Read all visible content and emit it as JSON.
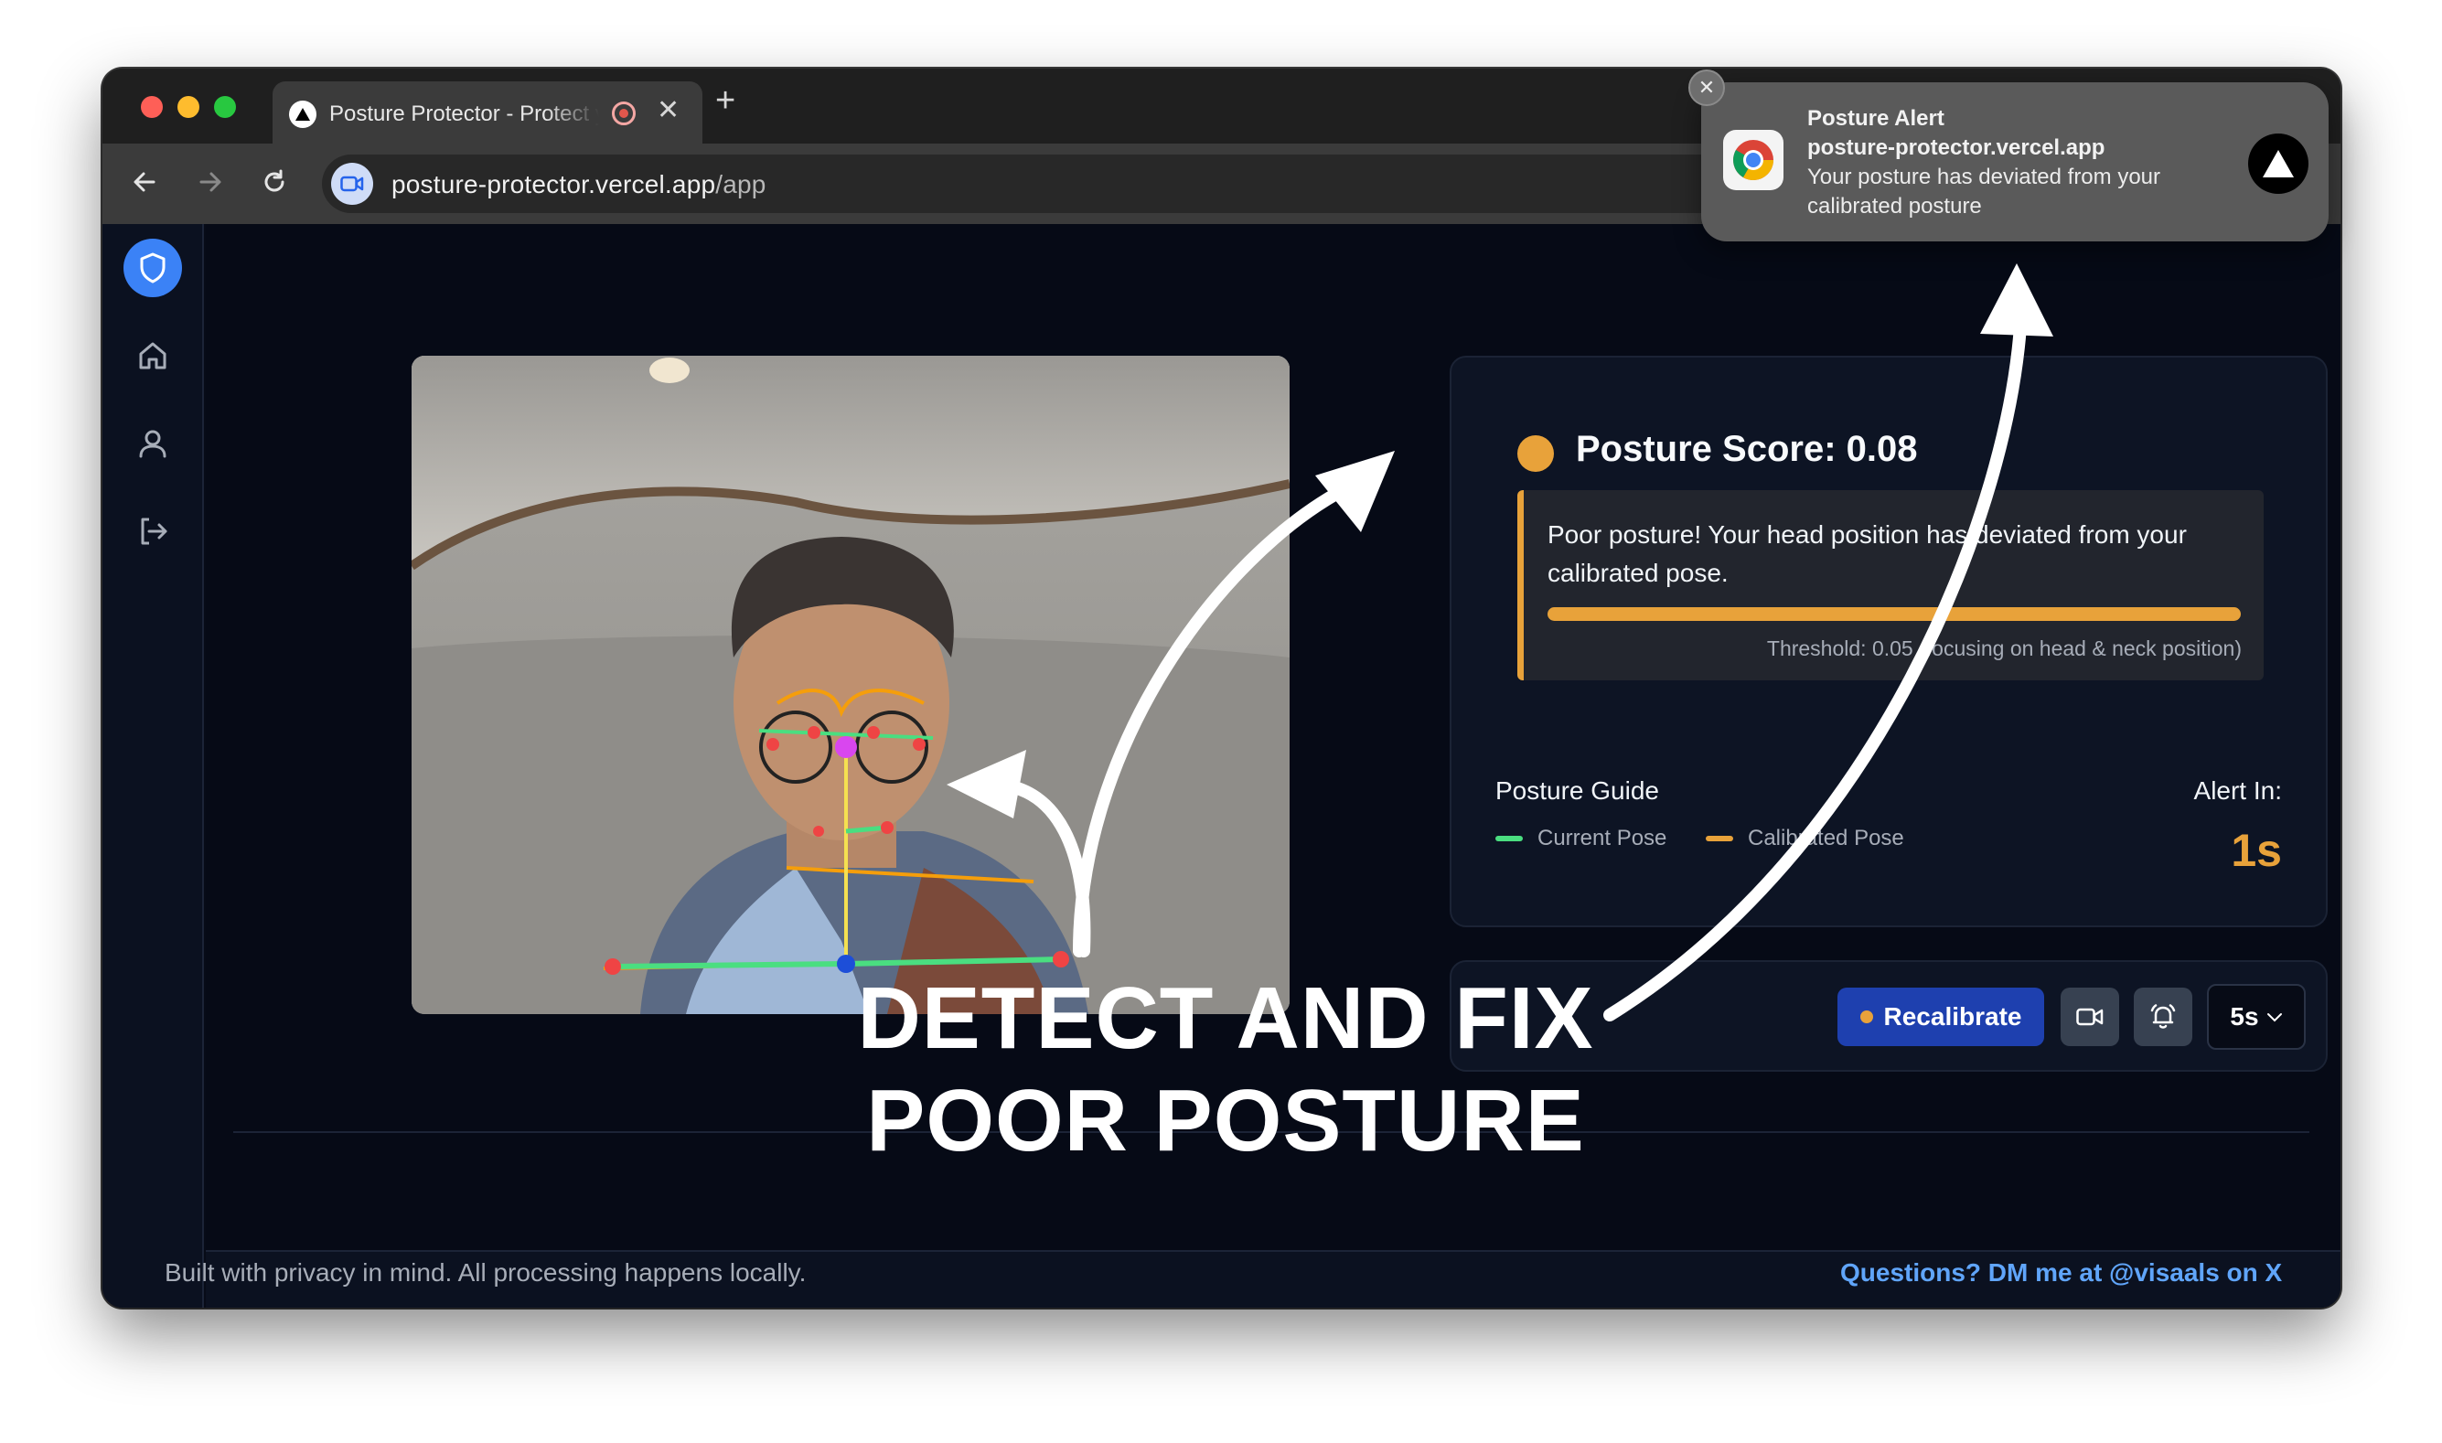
{
  "tab": {
    "title": "Posture Protector - Protect your posture",
    "close": "✕",
    "new_tab": "+"
  },
  "address_bar": {
    "host": "posture-protector.vercel.app",
    "path": "/app"
  },
  "sidebar": {
    "items": [
      "shield-icon",
      "home-icon",
      "user-icon",
      "logout-icon"
    ]
  },
  "video": {
    "state": "Live webcam feed with pose landmark overlay"
  },
  "posture": {
    "score_label": "Posture Score: 0.08",
    "status_color": "#e8a23a",
    "alert_message": "Poor posture! Your head position has deviated from your calibrated pose.",
    "deviation_bar_fill": 1.0,
    "threshold_text": "Threshold: 0.05 (focusing on head & neck position)"
  },
  "guide": {
    "title": "Posture Guide",
    "legend": [
      {
        "label": "Current Pose",
        "color": "#4ade80"
      },
      {
        "label": "Calibrated Pose",
        "color": "#e8a23a"
      }
    ]
  },
  "alert_in": {
    "label": "Alert In:",
    "value": "1s"
  },
  "controls": {
    "recalibrate": "Recalibrate",
    "interval": "5s"
  },
  "footer": {
    "left": "Built with privacy in mind. All processing happens locally.",
    "right": "Questions? DM me at @visaals on X"
  },
  "notification": {
    "title": "Posture Alert",
    "source": "posture-protector.vercel.app",
    "body": "Your posture has deviated from your calibrated posture",
    "close": "✕"
  },
  "caption": {
    "line1": "DETECT AND FIX",
    "line2": "POOR POSTURE"
  }
}
